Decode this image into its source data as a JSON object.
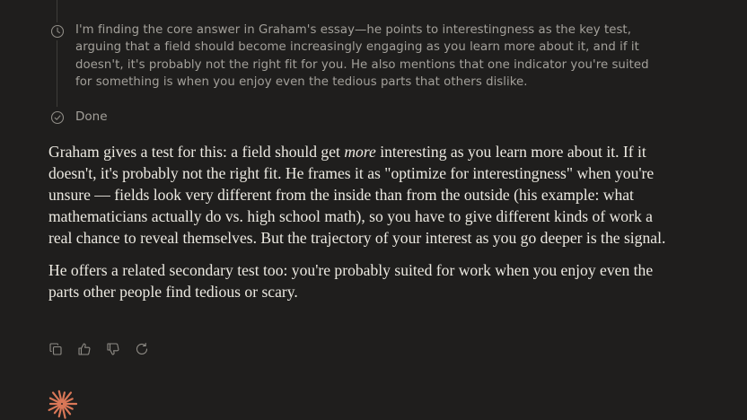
{
  "thinking": {
    "steps": [
      {
        "icon": "clock-icon",
        "text": "I'm finding the core answer in Graham's essay—he points to interestingness as the key test, arguing that a field should become increasingly engaging as you learn more about it, and if it doesn't, it's probably not the right fit for you. He also mentions that one indicator you're suited for something is when you enjoy even the tedious parts that others dislike."
      },
      {
        "icon": "check-circle-icon",
        "label": "Done"
      }
    ]
  },
  "answer": {
    "p1_before": "Graham gives a test for this: a field should get ",
    "p1_em": "more",
    "p1_after": " interesting as you learn more about it. If it doesn't, it's probably not the right fit. He frames it as \"optimize for interestingness\" when you're unsure — fields look very different from the inside than from the outside (his example: what mathematicians actually do vs. high school math), so you have to give different kinds of work a real chance to reveal themselves. But the trajectory of your interest as you go deeper is the signal.",
    "p2": "He offers a related secondary test too: you're probably suited for work when you enjoy even the parts other people find tedious or scary."
  },
  "actions": [
    {
      "icon": "copy-icon"
    },
    {
      "icon": "thumbs-up-icon"
    },
    {
      "icon": "thumbs-down-icon"
    },
    {
      "icon": "retry-icon"
    }
  ],
  "colors": {
    "background": "#1f1e1d",
    "text": "#ece9e1",
    "muted": "#a3a09a",
    "accent": "#d97757"
  }
}
